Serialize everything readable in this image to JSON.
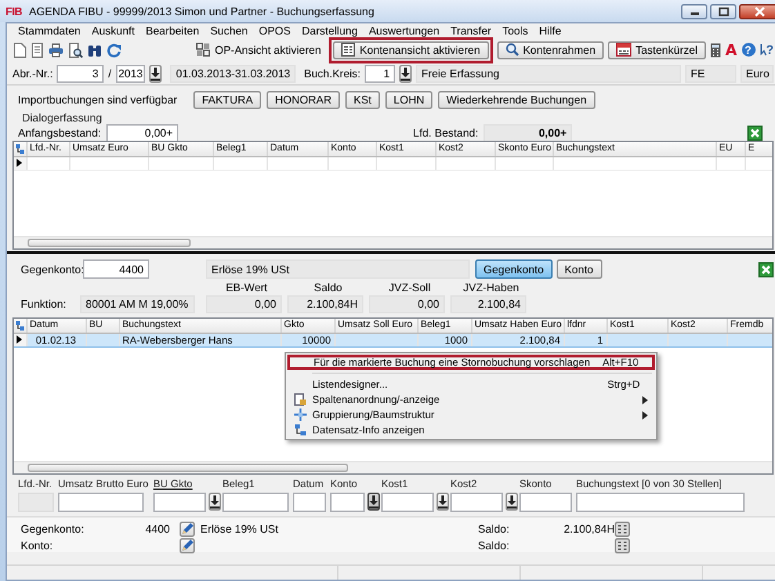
{
  "window": {
    "logo": "FIB",
    "title": "AGENDA FIBU - 99999/2013 Simon und Partner - Buchungserfassung"
  },
  "menu": [
    "Stammdaten",
    "Auskunft",
    "Bearbeiten",
    "Suchen",
    "OPOS",
    "Darstellung",
    "Auswertungen",
    "Transfer",
    "Tools",
    "Hilfe"
  ],
  "toolbar": {
    "buttons": [
      {
        "label": "OP-Ansicht aktivieren",
        "kind": "flat",
        "highlighted": false
      },
      {
        "label": "Kontenansicht aktivieren",
        "kind": "raised",
        "highlighted": true
      },
      {
        "label": "Kontenrahmen",
        "kind": "raised",
        "highlighted": false
      },
      {
        "label": "Tastenkürzel",
        "kind": "raised",
        "highlighted": false
      }
    ],
    "logo": "A",
    "help": "?",
    "context_help": "?"
  },
  "period": {
    "abr_label": "Abr.-Nr.:",
    "abr_nr": "3",
    "separator": "/",
    "year": "2013",
    "range": "01.03.2013-31.03.2013",
    "kreis_label": "Buch.Kreis:",
    "kreis": "1",
    "kreis_name": "Freie Erfassung",
    "code": "FE",
    "currency": "Euro"
  },
  "import": {
    "label": "Importbuchungen sind verfügbar",
    "buttons": [
      "FAKTURA",
      "HONORAR",
      "KSt",
      "LOHN",
      "Wiederkehrende Buchungen"
    ]
  },
  "dialog": {
    "title": "Dialogerfassung",
    "start_label": "Anfangsbestand:",
    "start_value": "0,00+",
    "current_label": "Lfd. Bestand:",
    "current_value": "0,00+"
  },
  "grid1": {
    "columns": [
      "Lfd.-Nr.",
      "Umsatz Euro",
      "BU Gkto",
      "Beleg1",
      "Datum",
      "Konto",
      "Kost1",
      "Kost2",
      "Skonto Euro",
      "Buchungstext",
      "EU",
      "E"
    ]
  },
  "account": {
    "label": "Gegenkonto:",
    "number": "4400",
    "name": "Erlöse 19% USt",
    "toggles": [
      {
        "label": "Gegenkonto",
        "selected": true
      },
      {
        "label": "Konto",
        "selected": false
      }
    ],
    "function_label": "Funktion:",
    "function": "80001 AM M 19,00%",
    "figures": [
      {
        "label": "EB-Wert",
        "value": "0,00"
      },
      {
        "label": "Saldo",
        "value": "2.100,84H"
      },
      {
        "label": "JVZ-Soll",
        "value": "0,00"
      },
      {
        "label": "JVZ-Haben",
        "value": "2.100,84"
      }
    ]
  },
  "grid2": {
    "columns": [
      "Datum",
      "BU",
      "Buchungstext",
      "Gkto",
      "Umsatz Soll Euro",
      "Beleg1",
      "Umsatz Haben Euro",
      "lfdnr",
      "Kost1",
      "Kost2",
      "Fremdb"
    ],
    "rows": [
      {
        "selected": true,
        "cells": [
          "01.02.13",
          null,
          "RA-Webersberger Hans",
          "10000",
          null,
          "1000",
          "2.100,84",
          "1",
          null,
          null,
          null
        ]
      }
    ]
  },
  "context_menu": {
    "sections": [
      [
        {
          "label": "Für die markierte Buchung eine Stornobuchung vorschlagen",
          "shortcut": "Alt+F10",
          "highlighted": true,
          "submenu": false
        }
      ],
      [
        {
          "label": "Listendesigner...",
          "shortcut": "Strg+D",
          "highlighted": false,
          "submenu": false
        },
        {
          "label": "Spaltenanordnung/-anzeige",
          "highlighted": false,
          "submenu": true
        },
        {
          "label": "Gruppierung/Baumstruktur",
          "highlighted": false,
          "submenu": true
        },
        {
          "label": "Datensatz-Info anzeigen",
          "highlighted": false,
          "submenu": false
        }
      ]
    ]
  },
  "entry": {
    "fields": [
      {
        "label": "Lfd.-Nr.",
        "underlined": false,
        "disabled": true
      },
      {
        "label": "Umsatz Brutto Euro",
        "underlined": false,
        "disabled": false
      },
      {
        "label": "BU Gkto",
        "underlined": true,
        "disabled": false,
        "lookup": {
          "pressed": false
        }
      },
      {
        "label": "Beleg1",
        "underlined": false,
        "disabled": false
      },
      {
        "label": "Datum",
        "underlined": false,
        "disabled": false
      },
      {
        "label": "Konto",
        "underlined": false,
        "disabled": false,
        "lookup": {
          "pressed": true
        }
      },
      {
        "label": "Kost1",
        "underlined": false,
        "disabled": false,
        "lookup": {
          "pressed": false
        }
      },
      {
        "label": "Kost2",
        "underlined": false,
        "disabled": false,
        "lookup": {
          "pressed": false
        }
      },
      {
        "label": "Skonto",
        "underlined": false,
        "disabled": false
      },
      {
        "label": "Buchungstext [0 von 30 Stellen]",
        "underlined": false,
        "disabled": false
      }
    ]
  },
  "summary": {
    "rows": [
      {
        "label": "Gegenkonto:",
        "number": "4400",
        "name": "Erlöse 19% USt",
        "saldo_label": "Saldo:",
        "saldo": "2.100,84H"
      },
      {
        "label": "Konto:",
        "saldo_label": "Saldo:"
      }
    ]
  }
}
